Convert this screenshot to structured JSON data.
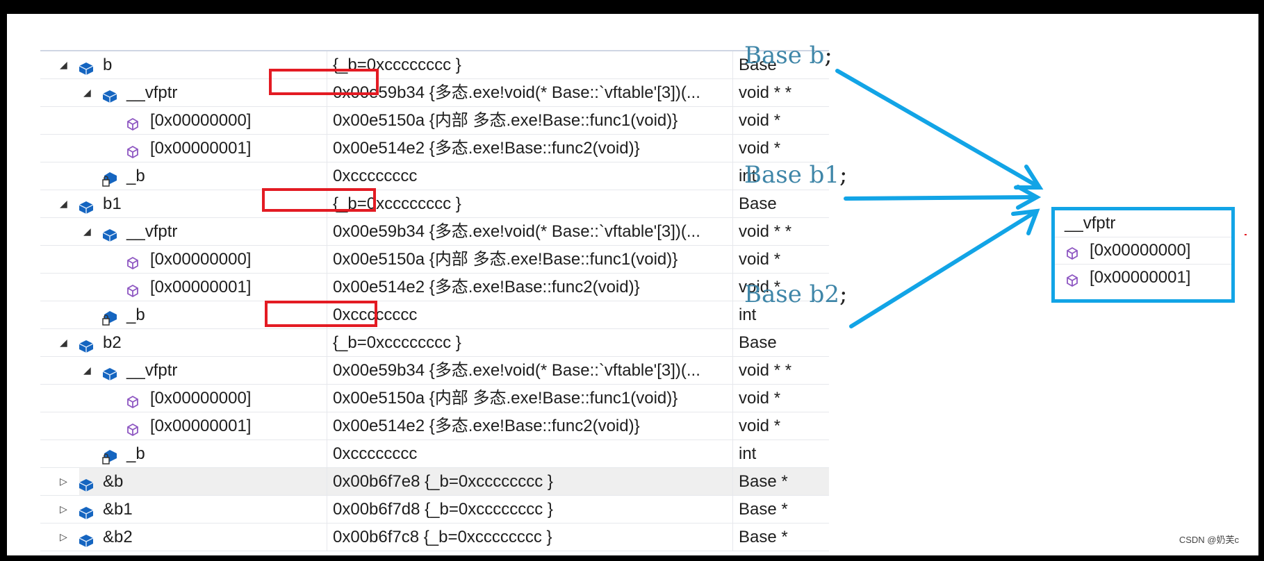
{
  "watch_rows": [
    {
      "indent": 0,
      "expander": "open",
      "icon": "object-icon",
      "name": "b",
      "value": "{_b=0xcccccccc }",
      "type": "Base"
    },
    {
      "indent": 1,
      "expander": "open",
      "icon": "object-icon",
      "name": "__vfptr",
      "value": "0x00e59b34 {多态.exe!void(* Base::`vftable'[3])(...",
      "type": "void * *"
    },
    {
      "indent": 2,
      "expander": "none",
      "icon": "method-icon",
      "name": "[0x00000000]",
      "value": "0x00e5150a {内部 多态.exe!Base::func1(void)}",
      "type": "void *"
    },
    {
      "indent": 2,
      "expander": "none",
      "icon": "method-icon",
      "name": "[0x00000001]",
      "value": "0x00e514e2 {多态.exe!Base::func2(void)}",
      "type": "void *"
    },
    {
      "indent": 1,
      "expander": "none",
      "icon": "locked-field-icon",
      "name": "_b",
      "value": "0xcccccccc",
      "type": "int"
    },
    {
      "indent": 0,
      "expander": "open",
      "icon": "object-icon",
      "name": "b1",
      "value": "{_b=0xcccccccc }",
      "type": "Base"
    },
    {
      "indent": 1,
      "expander": "open",
      "icon": "object-icon",
      "name": "__vfptr",
      "value": "0x00e59b34 {多态.exe!void(* Base::`vftable'[3])(...",
      "type": "void * *"
    },
    {
      "indent": 2,
      "expander": "none",
      "icon": "method-icon",
      "name": "[0x00000000]",
      "value": "0x00e5150a {内部 多态.exe!Base::func1(void)}",
      "type": "void *"
    },
    {
      "indent": 2,
      "expander": "none",
      "icon": "method-icon",
      "name": "[0x00000001]",
      "value": "0x00e514e2 {多态.exe!Base::func2(void)}",
      "type": "void *"
    },
    {
      "indent": 1,
      "expander": "none",
      "icon": "locked-field-icon",
      "name": "_b",
      "value": "0xcccccccc",
      "type": "int"
    },
    {
      "indent": 0,
      "expander": "open",
      "icon": "object-icon",
      "name": "b2",
      "value": "{_b=0xcccccccc }",
      "type": "Base"
    },
    {
      "indent": 1,
      "expander": "open",
      "icon": "object-icon",
      "name": "__vfptr",
      "value": "0x00e59b34 {多态.exe!void(* Base::`vftable'[3])(...",
      "type": "void * *"
    },
    {
      "indent": 2,
      "expander": "none",
      "icon": "method-icon",
      "name": "[0x00000000]",
      "value": "0x00e5150a {内部 多态.exe!Base::func1(void)}",
      "type": "void *"
    },
    {
      "indent": 2,
      "expander": "none",
      "icon": "method-icon",
      "name": "[0x00000001]",
      "value": "0x00e514e2 {多态.exe!Base::func2(void)}",
      "type": "void *"
    },
    {
      "indent": 1,
      "expander": "none",
      "icon": "locked-field-icon",
      "name": "_b",
      "value": "0xcccccccc",
      "type": "int"
    },
    {
      "indent": 0,
      "expander": "closed",
      "icon": "object-icon",
      "name": "&b",
      "value": "0x00b6f7e8 {_b=0xcccccccc }",
      "type": "Base *",
      "selected": true
    },
    {
      "indent": 0,
      "expander": "closed",
      "icon": "object-icon",
      "name": "&b1",
      "value": "0x00b6f7d8 {_b=0xcccccccc }",
      "type": "Base *"
    },
    {
      "indent": 0,
      "expander": "closed",
      "icon": "object-icon",
      "name": "&b2",
      "value": "0x00b6f7c8 {_b=0xcccccccc }",
      "type": "Base *"
    }
  ],
  "annotations": [
    {
      "text": "Base b",
      "semi": ";"
    },
    {
      "text": "Base b1",
      "semi": ";"
    },
    {
      "text": "Base b2",
      "semi": ";"
    }
  ],
  "vftable_box": {
    "title": "__vfptr",
    "entries": [
      "[0x00000000]",
      "[0x00000001]"
    ]
  },
  "watermark": "CSDN @奶芙c",
  "colors": {
    "highlight_red": "#e31b23",
    "arrow_blue": "#12a4e6",
    "annotation_text": "#3f86a8",
    "object_icon": "#1565c0",
    "method_icon": "#8e57c2"
  }
}
